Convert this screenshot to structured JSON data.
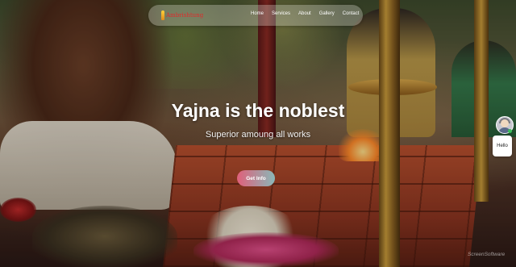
{
  "navbar": {
    "logo_text": "Ambrishtung",
    "links": [
      "Home",
      "Services",
      "About",
      "Gallery",
      "Contact"
    ]
  },
  "hero": {
    "title": "Yajna is the noblest",
    "subtitle": "Superior amoung all works",
    "cta_label": "Get Info"
  },
  "chat_widget": {
    "greeting": "Hello",
    "status_color": "#3ac05a"
  },
  "watermark": "ScreenSoftware",
  "colors": {
    "logo": "#e02a2a",
    "cta_start": "#e0607a",
    "cta_end": "#8ab8b8"
  }
}
